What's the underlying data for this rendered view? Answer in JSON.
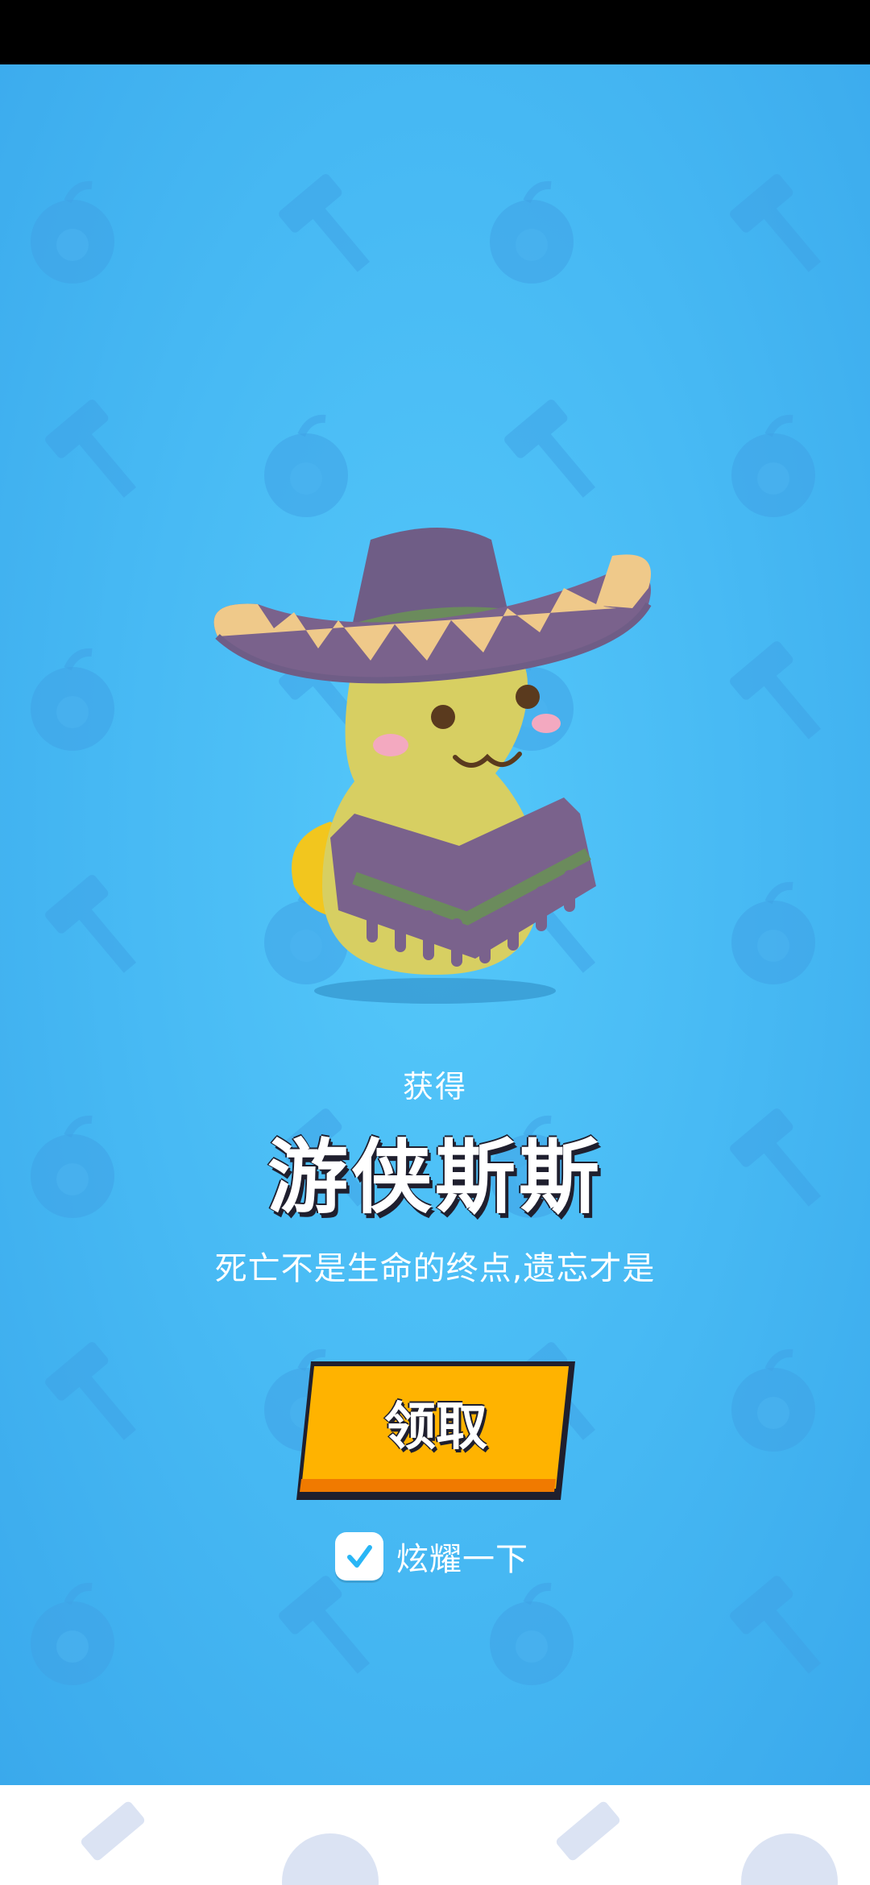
{
  "reward": {
    "obtain_label": "获得",
    "item_name": "游侠斯斯",
    "description": "死亡不是生命的终点,遗忘才是",
    "character_icon": "sombrero-poncho-character"
  },
  "claim_button": {
    "label": "领取",
    "color": "#ffb300"
  },
  "share_toggle": {
    "label": "炫耀一下",
    "checked": true,
    "check_icon": "checkmark-icon"
  },
  "theme": {
    "background": "#4bbdf6",
    "pattern_icons": [
      "apple-bomb-icon",
      "hammer-icon"
    ]
  }
}
